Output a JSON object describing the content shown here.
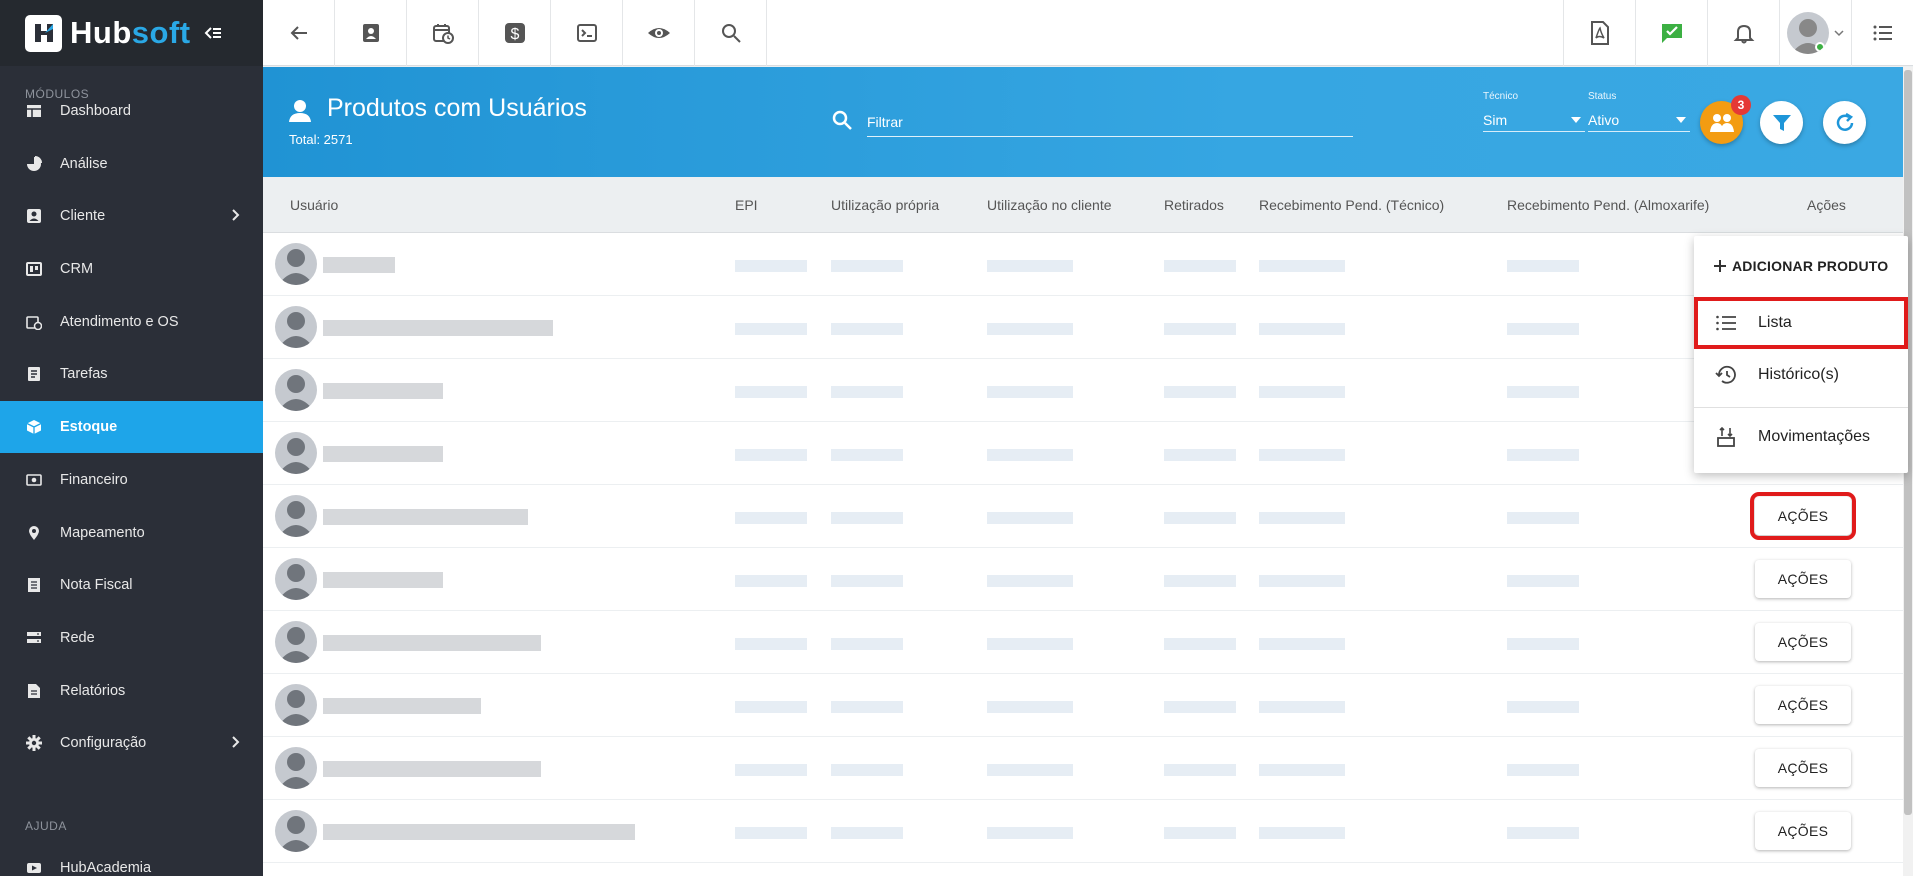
{
  "app": {
    "logo_hub": "Hub",
    "logo_soft": "soft"
  },
  "sidebar": {
    "section_modules": "MÓDULOS",
    "section_help": "AJUDA",
    "items": [
      {
        "label": "Dashboard",
        "icon": "dashboard-icon"
      },
      {
        "label": "Análise",
        "icon": "pie-chart-icon"
      },
      {
        "label": "Cliente",
        "icon": "contact-card-icon",
        "has_submenu": true
      },
      {
        "label": "CRM",
        "icon": "crm-icon"
      },
      {
        "label": "Atendimento e OS",
        "icon": "calendar-clock-icon"
      },
      {
        "label": "Tarefas",
        "icon": "tasks-icon"
      },
      {
        "label": "Estoque",
        "icon": "box-icon",
        "active": true
      },
      {
        "label": "Financeiro",
        "icon": "money-icon"
      },
      {
        "label": "Mapeamento",
        "icon": "map-pin-icon"
      },
      {
        "label": "Nota Fiscal",
        "icon": "invoice-icon"
      },
      {
        "label": "Rede",
        "icon": "network-icon"
      },
      {
        "label": "Relatórios",
        "icon": "report-icon"
      },
      {
        "label": "Configuração",
        "icon": "gear-icon",
        "has_submenu": true
      }
    ],
    "help_items": [
      {
        "label": "HubAcademia",
        "icon": "video-icon"
      }
    ]
  },
  "header": {
    "title": "Produtos com Usuários",
    "total": "Total: 2571",
    "filter_placeholder": "Filtrar",
    "tecnico_label": "Técnico",
    "tecnico_value": "Sim",
    "status_label": "Status",
    "status_value": "Ativo",
    "notification_count": "3"
  },
  "table": {
    "columns": [
      "Usuário",
      "EPI",
      "Utilização própria",
      "Utilização no cliente",
      "Retirados",
      "Recebimento Pend. (Técnico)",
      "Recebimento Pend. (Almoxarife)",
      "Ações"
    ],
    "action_label": "AÇÕES",
    "row_count": 10
  },
  "menu": {
    "add_product": "ADICIONAR PRODUTO",
    "items": [
      {
        "label": "Lista",
        "icon": "list-icon"
      },
      {
        "label": "Histórico(s)",
        "icon": "history-icon"
      },
      {
        "label": "Movimentações",
        "icon": "movements-icon"
      }
    ]
  },
  "colors": {
    "accent": "#1ea5e9",
    "sidebar_bg": "#2b2f38",
    "highlight": "#e01b1b",
    "orange": "#f39c12"
  }
}
